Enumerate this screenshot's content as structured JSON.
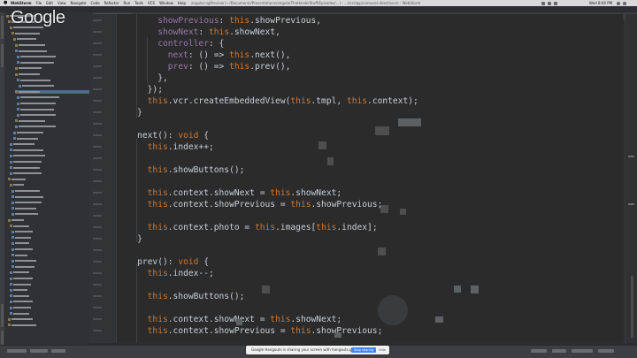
{
  "menubar": {
    "app_name": "WebStorm",
    "menus": [
      "File",
      "Edit",
      "View",
      "Navigate",
      "Code",
      "Refactor",
      "Run",
      "Tools",
      "VCS",
      "Window",
      "Help"
    ],
    "path_text": "angular-ngPreview [~/Documents/Presentations/angularTheHarderStuff/Episodes/...] - .../src/app/carousel.directive.ts - WebStorm",
    "clock": "Wed 8:04 PM"
  },
  "overlay": {
    "google_logo": "Google"
  },
  "code": {
    "lines": [
      [
        {
          "t": "        ",
          "c": "plain"
        },
        {
          "t": "showPrevious",
          "c": "prop"
        },
        {
          "t": ": ",
          "c": "plain"
        },
        {
          "t": "this",
          "c": "kw"
        },
        {
          "t": ".showPrevious,",
          "c": "plain"
        }
      ],
      [
        {
          "t": "        ",
          "c": "plain"
        },
        {
          "t": "showNext",
          "c": "prop"
        },
        {
          "t": ": ",
          "c": "plain"
        },
        {
          "t": "this",
          "c": "kw"
        },
        {
          "t": ".showNext,",
          "c": "plain"
        }
      ],
      [
        {
          "t": "        ",
          "c": "plain"
        },
        {
          "t": "controller",
          "c": "prop"
        },
        {
          "t": ": {",
          "c": "plain"
        }
      ],
      [
        {
          "t": "          ",
          "c": "plain"
        },
        {
          "t": "next",
          "c": "prop"
        },
        {
          "t": ": () => ",
          "c": "plain"
        },
        {
          "t": "this",
          "c": "kw"
        },
        {
          "t": ".next(),",
          "c": "plain"
        }
      ],
      [
        {
          "t": "          ",
          "c": "plain"
        },
        {
          "t": "prev",
          "c": "prop"
        },
        {
          "t": ": () => ",
          "c": "plain"
        },
        {
          "t": "this",
          "c": "kw"
        },
        {
          "t": ".prev(),",
          "c": "plain"
        }
      ],
      [
        {
          "t": "        },",
          "c": "plain"
        }
      ],
      [
        {
          "t": "      });",
          "c": "plain"
        }
      ],
      [
        {
          "t": "      ",
          "c": "plain"
        },
        {
          "t": "this",
          "c": "kw"
        },
        {
          "t": ".vcr.createEmbeddedView(",
          "c": "plain"
        },
        {
          "t": "this",
          "c": "kw"
        },
        {
          "t": ".tmpl, ",
          "c": "plain"
        },
        {
          "t": "this",
          "c": "kw"
        },
        {
          "t": ".context);",
          "c": "plain"
        }
      ],
      [
        {
          "t": "    }",
          "c": "plain"
        }
      ],
      [
        {
          "t": "",
          "c": "plain"
        }
      ],
      [
        {
          "t": "    next(): ",
          "c": "plain"
        },
        {
          "t": "void",
          "c": "kw"
        },
        {
          "t": " {",
          "c": "plain"
        }
      ],
      [
        {
          "t": "      ",
          "c": "plain"
        },
        {
          "t": "this",
          "c": "kw"
        },
        {
          "t": ".index++;",
          "c": "plain"
        }
      ],
      [
        {
          "t": "",
          "c": "plain"
        }
      ],
      [
        {
          "t": "      ",
          "c": "plain"
        },
        {
          "t": "this",
          "c": "kw"
        },
        {
          "t": ".showButtons();",
          "c": "plain"
        }
      ],
      [
        {
          "t": "",
          "c": "plain"
        }
      ],
      [
        {
          "t": "      ",
          "c": "plain"
        },
        {
          "t": "this",
          "c": "kw"
        },
        {
          "t": ".context.showNext = ",
          "c": "plain"
        },
        {
          "t": "this",
          "c": "kw"
        },
        {
          "t": ".showNext;",
          "c": "plain"
        }
      ],
      [
        {
          "t": "      ",
          "c": "plain"
        },
        {
          "t": "this",
          "c": "kw"
        },
        {
          "t": ".context.showPrevious = ",
          "c": "plain"
        },
        {
          "t": "this",
          "c": "kw"
        },
        {
          "t": ".showPrevious;",
          "c": "plain"
        }
      ],
      [
        {
          "t": "",
          "c": "plain"
        }
      ],
      [
        {
          "t": "      ",
          "c": "plain"
        },
        {
          "t": "this",
          "c": "kw"
        },
        {
          "t": ".context.photo = ",
          "c": "plain"
        },
        {
          "t": "this",
          "c": "kw"
        },
        {
          "t": ".images[",
          "c": "plain"
        },
        {
          "t": "this",
          "c": "kw"
        },
        {
          "t": ".index];",
          "c": "plain"
        }
      ],
      [
        {
          "t": "    }",
          "c": "plain"
        }
      ],
      [
        {
          "t": "",
          "c": "plain"
        }
      ],
      [
        {
          "t": "    prev(): ",
          "c": "plain"
        },
        {
          "t": "void",
          "c": "kw"
        },
        {
          "t": " {",
          "c": "plain"
        }
      ],
      [
        {
          "t": "      ",
          "c": "plain"
        },
        {
          "t": "this",
          "c": "kw"
        },
        {
          "t": ".index--;",
          "c": "plain"
        }
      ],
      [
        {
          "t": "",
          "c": "plain"
        }
      ],
      [
        {
          "t": "      ",
          "c": "plain"
        },
        {
          "t": "this",
          "c": "kw"
        },
        {
          "t": ".showButtons();",
          "c": "plain"
        }
      ],
      [
        {
          "t": "",
          "c": "plain"
        }
      ],
      [
        {
          "t": "      ",
          "c": "plain"
        },
        {
          "t": "this",
          "c": "kw"
        },
        {
          "t": ".context.showNext = ",
          "c": "plain"
        },
        {
          "t": "this",
          "c": "kw"
        },
        {
          "t": ".showNext;",
          "c": "plain"
        }
      ],
      [
        {
          "t": "      ",
          "c": "plain"
        },
        {
          "t": "this",
          "c": "kw"
        },
        {
          "t": ".context.showPrevious = ",
          "c": "plain"
        },
        {
          "t": "this",
          "c": "kw"
        },
        {
          "t": ".showPrevious;",
          "c": "plain"
        }
      ]
    ]
  },
  "colors": {
    "plain": "#c9ced6",
    "kw": "#cc7832",
    "prop": "#9876aa"
  },
  "share_bar": {
    "message": "Google Hangouts is sharing your screen with hangouts.google.com.",
    "stop_label": "Stop sharing",
    "hide_label": "Hide"
  }
}
